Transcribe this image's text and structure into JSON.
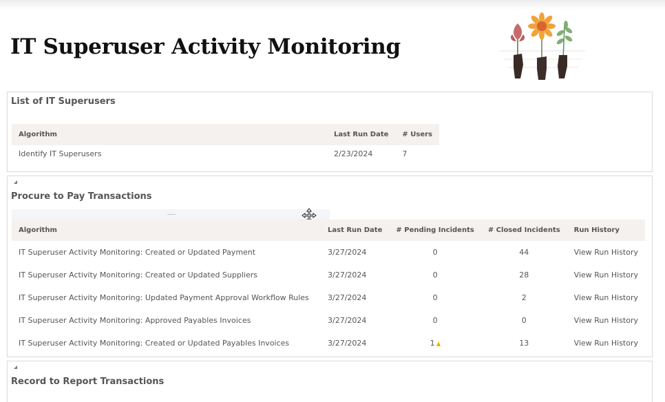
{
  "page": {
    "title": "IT Superuser Activity Monitoring"
  },
  "colors": {
    "header_bg": "#f4f1ef",
    "panel_border": "#d9d9d9",
    "text": "#555555",
    "flag": "#e1b300"
  },
  "superusers": {
    "title": "List of IT Superusers",
    "columns": [
      "Algorithm",
      "Last Run Date",
      "# Users"
    ],
    "rows": [
      {
        "algorithm": "Identify IT Superusers",
        "last_run": "2/23/2024",
        "users": "7"
      }
    ]
  },
  "procure": {
    "title": "Procure to Pay Transactions",
    "columns": [
      "Algorithm",
      "Last Run Date",
      "# Pending Incidents",
      "# Closed Incidents",
      "Run History"
    ],
    "rows": [
      {
        "algorithm": "IT Superuser Activity Monitoring: Created or Updated Payment",
        "last_run": "3/27/2024",
        "pending": "0",
        "closed": "44",
        "history": "View Run History"
      },
      {
        "algorithm": "IT Superuser Activity Monitoring: Created or Updated Suppliers",
        "last_run": "3/27/2024",
        "pending": "0",
        "closed": "28",
        "history": "View Run History"
      },
      {
        "algorithm": "IT Superuser Activity Monitoring: Updated Payment Approval Workflow Rules",
        "last_run": "3/27/2024",
        "pending": "0",
        "closed": "2",
        "history": "View Run History"
      },
      {
        "algorithm": "IT Superuser Activity Monitoring: Approved Payables Invoices",
        "last_run": "3/27/2024",
        "pending": "0",
        "closed": "0",
        "history": "View Run History"
      },
      {
        "algorithm": "IT Superuser Activity Monitoring: Created or Updated Payables Invoices",
        "last_run": "3/27/2024",
        "pending": "1",
        "closed": "13",
        "history": "View Run History"
      }
    ]
  },
  "record": {
    "title": "Record to Report Transactions"
  }
}
